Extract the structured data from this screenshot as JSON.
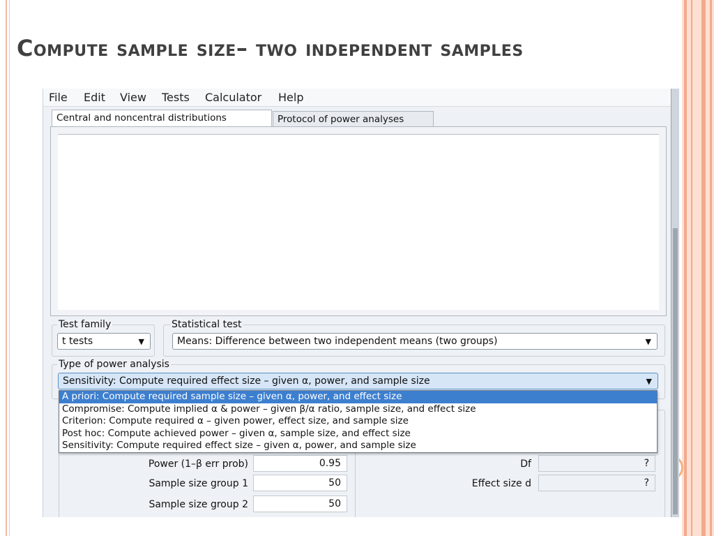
{
  "slide": {
    "title": "Compute sample size– two independent samples"
  },
  "menu": [
    "File",
    "Edit",
    "View",
    "Tests",
    "Calculator",
    "Help"
  ],
  "tabs": [
    {
      "label": "Central and noncentral distributions",
      "active": true
    },
    {
      "label": "Protocol of power analyses",
      "active": false
    }
  ],
  "test_family": {
    "label": "Test family",
    "value": "t tests"
  },
  "statistical_test": {
    "label": "Statistical test",
    "value": "Means: Difference between two independent means (two groups)"
  },
  "power_analysis": {
    "label": "Type of power analysis",
    "value": "Sensitivity: Compute required effect size – given α, power, and sample size",
    "options": [
      "A priori: Compute required sample size – given α, power, and effect size",
      "Compromise: Compute implied α & power – given β/α ratio, sample size, and effect size",
      "Criterion: Compute required α – given power, effect size, and sample size",
      "Post hoc: Compute achieved power – given α, sample size, and effect size",
      "Sensitivity: Compute required effect size – given α, power, and sample size"
    ],
    "highlighted_index": 0
  },
  "inputs": [
    {
      "label": "Power (1–β err prob)",
      "value": "0.95"
    },
    {
      "label": "Sample size group 1",
      "value": "50"
    },
    {
      "label": "Sample size group 2",
      "value": "50"
    }
  ],
  "outputs": [
    {
      "label": "Df",
      "value": "?"
    },
    {
      "label": "Effect size d",
      "value": "?"
    }
  ],
  "icons": {
    "dropdown_arrow": "▼"
  },
  "colors": {
    "title_text": "#404040",
    "slide_accent": "#f3a98c",
    "selection_highlight": "#3d7fcf"
  }
}
